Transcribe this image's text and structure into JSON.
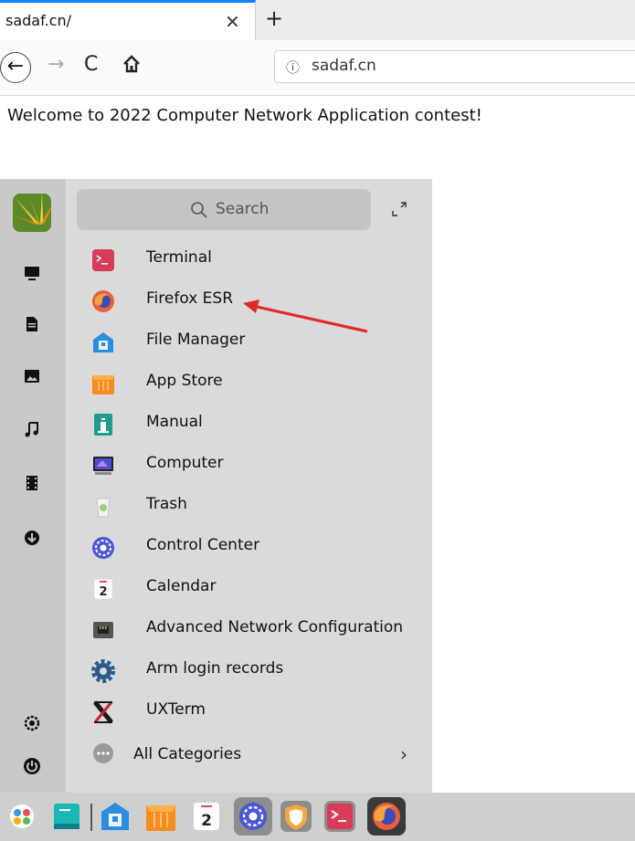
{
  "browser": {
    "tab_title": "sadaf.cn/",
    "tab_close": "×",
    "new_tab": "+",
    "nav_back": "←",
    "nav_forward": "→",
    "nav_reload": "C",
    "url_info_icon": "ⓘ",
    "url": "sadaf.cn"
  },
  "page": {
    "welcome": "Welcome to 2022 Computer Network Application contest!"
  },
  "launcher": {
    "search_placeholder": "Search",
    "sidebar_icons": [
      "avatar",
      "computer-icon",
      "document-icon",
      "picture-icon",
      "music-icon",
      "video-icon",
      "download-icon",
      "settings-icon",
      "power-icon"
    ],
    "apps": [
      {
        "label": "Terminal",
        "icon": "terminal-icon",
        "color": "#d93a58"
      },
      {
        "label": "Firefox ESR",
        "icon": "firefox-icon",
        "color": "#e8603c"
      },
      {
        "label": "File Manager",
        "icon": "file-manager-icon",
        "color": "#2b8de0"
      },
      {
        "label": "App Store",
        "icon": "app-store-icon",
        "color": "#f68b1f"
      },
      {
        "label": "Manual",
        "icon": "manual-icon",
        "color": "#1f9d8a"
      },
      {
        "label": "Computer",
        "icon": "computer-icon",
        "color": "#4a4fd0"
      },
      {
        "label": "Trash",
        "icon": "trash-icon",
        "color": "#9ccf7a"
      },
      {
        "label": "Control Center",
        "icon": "control-center-icon",
        "color": "#4b57d6"
      },
      {
        "label": "Calendar",
        "icon": "calendar-icon",
        "color": "#ffffff"
      },
      {
        "label": "Advanced Network Configuration",
        "icon": "network-icon",
        "color": "#555555"
      },
      {
        "label": "Arm login records",
        "icon": "gear-icon",
        "color": "#2a5b8c"
      },
      {
        "label": "UXTerm",
        "icon": "x-icon",
        "color": "#c4262e"
      }
    ],
    "all_categories": "All Categories",
    "all_categories_chevron": "›"
  },
  "calendar_day": "2",
  "dock": {
    "items": [
      "launcher-icon",
      "deepin-editor-icon",
      "file-manager-icon",
      "app-store-icon",
      "calendar-icon",
      "control-center-icon",
      "security-icon",
      "terminal-icon",
      "firefox-icon"
    ]
  },
  "colors": {
    "accent": "#0a84ff",
    "annotation_arrow": "#e02a2a"
  }
}
